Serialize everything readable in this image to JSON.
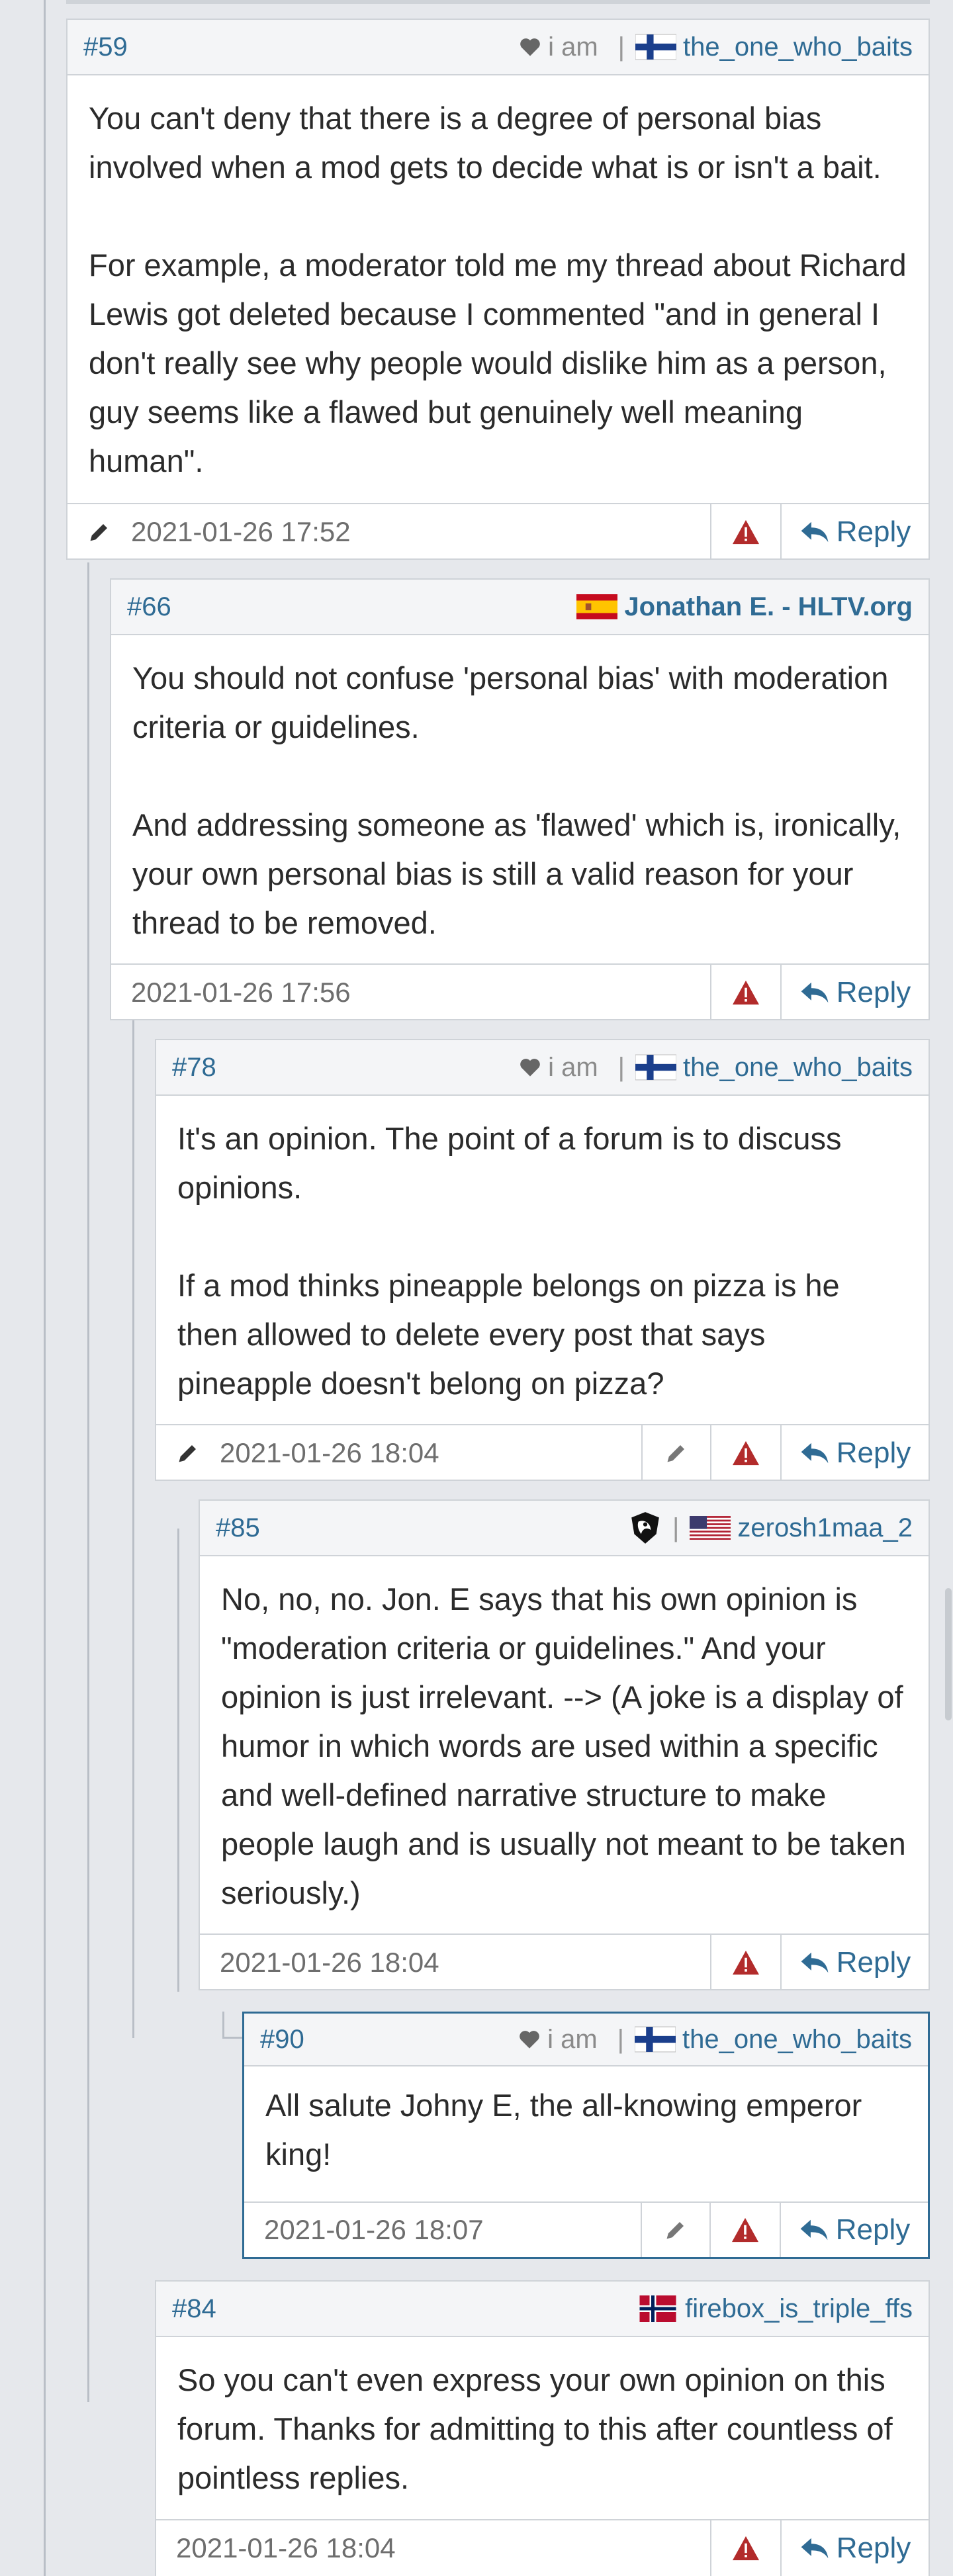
{
  "posts": [
    {
      "number": "#59",
      "user_note": "i am",
      "username": "the_one_who_baits",
      "flag": "finland",
      "paragraphs": [
        "You can't deny that there is a degree of personal bias involved when a mod gets to decide what is or isn't a bait.",
        "For example, a moderator told me my thread about Richard Lewis got deleted because I commented \"and in general I don't really see why people would dislike him as a person, guy seems like a flawed but genuinely well meaning human\"."
      ],
      "timestamp": "2021-01-26 17:52",
      "reply_label": "Reply"
    },
    {
      "number": "#66",
      "username": "Jonathan E. - HLTV.org",
      "flag": "spain",
      "paragraphs": [
        "You should not confuse 'personal bias' with moderation criteria or guidelines.",
        "And addressing someone as 'flawed' which is, ironically, your own personal bias is still a valid reason for your thread to be removed."
      ],
      "timestamp": "2021-01-26 17:56",
      "reply_label": "Reply"
    },
    {
      "number": "#78",
      "user_note": "i am",
      "username": "the_one_who_baits",
      "flag": "finland",
      "paragraphs": [
        "It's an opinion. The point of a forum is to discuss opinions.",
        "If a mod thinks pineapple belongs on pizza is he then allowed to delete every post that says pineapple doesn't belong on pizza?"
      ],
      "timestamp": "2021-01-26 18:04",
      "reply_label": "Reply"
    },
    {
      "number": "#85",
      "username": "zerosh1maa_2",
      "flag": "usa",
      "team_icon": "liquid-team-icon",
      "paragraphs": [
        "No, no, no. Jon. E says that his own opinion is \"moderation criteria or guidelines.\" And your opinion is just irrelevant. --> (A joke is a display of humor in which words are used within a specific and well-defined narrative structure to make people laugh and is usually not meant to be taken seriously.)"
      ],
      "timestamp": "2021-01-26 18:04",
      "reply_label": "Reply"
    },
    {
      "number": "#90",
      "user_note": "i am",
      "username": "the_one_who_baits",
      "flag": "finland",
      "paragraphs": [
        "All salute Johny E, the all-knowing emperor king!"
      ],
      "timestamp": "2021-01-26 18:07",
      "reply_label": "Reply"
    },
    {
      "number": "#84",
      "username": "firebox_is_triple_ffs",
      "flag": "norway",
      "paragraphs": [
        "So you can't even express your own opinion on this forum. Thanks for admitting to this after countless of pointless replies."
      ],
      "timestamp": "2021-01-26 18:04",
      "reply_label": "Reply"
    }
  ],
  "colors": {
    "link": "#2f6b94",
    "warn": "#b22b2b",
    "highlight_border": "#2f6b94"
  }
}
